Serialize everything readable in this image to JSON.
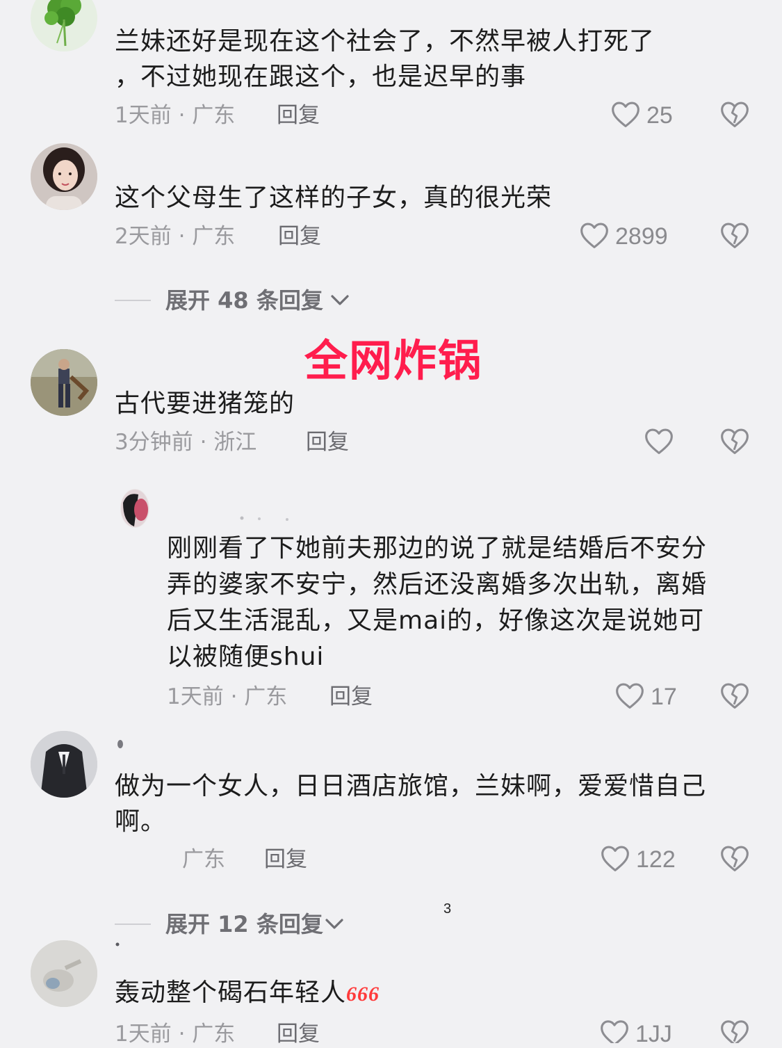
{
  "overlay": {
    "title": "全网炸锅"
  },
  "page_number": "3",
  "comments": [
    {
      "text_lines": [
        "兰妹还好是现在这个社会了，不然早被人打死了",
        "，不过她现在跟这个，也是迟早的事"
      ],
      "meta": "1天前 · 广东",
      "reply_label": "回复",
      "likes": "25",
      "avatar_icon": "cilantro-avatar"
    },
    {
      "text_lines": [
        "这个父母生了这样的子女，真的很光荣"
      ],
      "meta": "2天前 · 广东",
      "reply_label": "回复",
      "likes": "2899",
      "avatar_icon": "woman-portrait-avatar"
    },
    {
      "text_lines": [
        "古代要进猪笼的"
      ],
      "meta": "3分钟前 · 浙江",
      "reply_label": "回复",
      "likes": "",
      "avatar_icon": "outdoor-person-avatar"
    },
    {
      "text_lines": [
        "刚刚看了下她前夫那边的说了就是结婚后不安分",
        "弄的婆家不安宁，然后还没离婚多次出轨，离婚",
        "后又生活混乱，又是mai的，好像这次是说她可",
        "以被随便shui"
      ],
      "meta": "1天前 · 广东",
      "reply_label": "回复",
      "likes": "17",
      "avatar_icon": "dark-avatar"
    },
    {
      "text_lines": [
        "做为一个女人，日日酒店旅馆，兰妹啊，爱爱惜自己",
        "啊。"
      ],
      "meta": "广东",
      "reply_label": "回复",
      "likes": "122",
      "avatar_icon": "suit-avatar"
    },
    {
      "text_lines": [
        "轰动整个碣石年轻人"
      ],
      "suffix": "666",
      "meta": "1天前 · 广东",
      "reply_label": "回复",
      "likes": "1JJ",
      "avatar_icon": "hand-avatar"
    }
  ],
  "expanders": [
    {
      "label": "展开 48 条回复"
    },
    {
      "label": "展开 12 条回复"
    }
  ],
  "colors": {
    "background": "#f1f1f3",
    "overlay": "#ff1d4d",
    "meta": "#9a9a9e"
  }
}
